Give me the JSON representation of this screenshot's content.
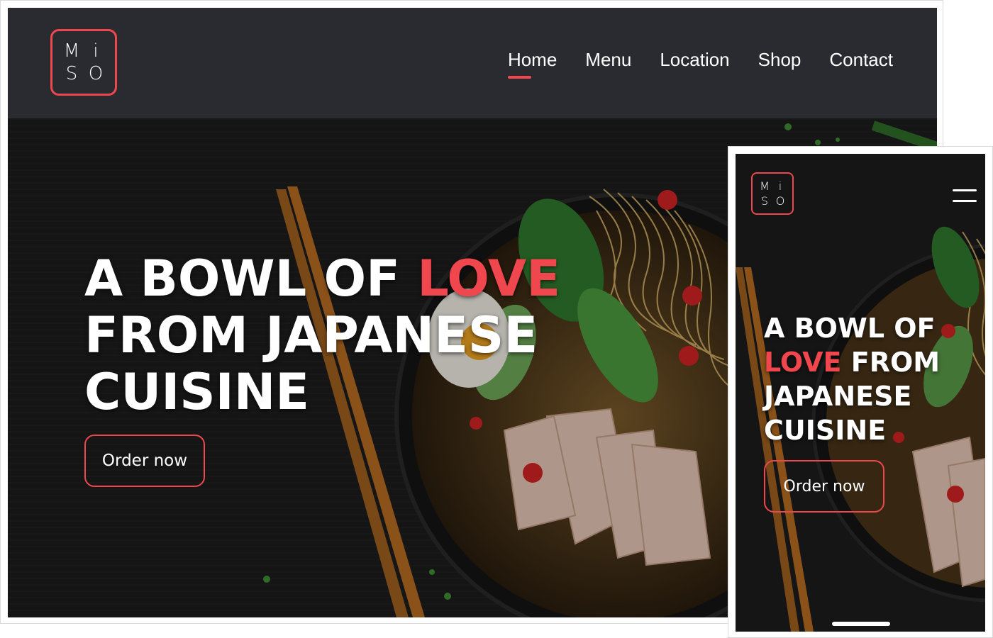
{
  "brand": {
    "logo_letters": [
      "M",
      "i",
      "S",
      "O"
    ],
    "accent_color": "#f0474f",
    "nav_background": "#2a2b30"
  },
  "desktop": {
    "nav": [
      {
        "label": "Home",
        "active": true
      },
      {
        "label": "Menu",
        "active": false
      },
      {
        "label": "Location",
        "active": false
      },
      {
        "label": "Shop",
        "active": false
      },
      {
        "label": "Contact",
        "active": false
      }
    ],
    "hero": {
      "line1_pre": "A BOWL OF ",
      "line1_accent": "LOVE",
      "line2": "FROM JAPANESE",
      "line3": "CUISINE",
      "cta_label": "Order now",
      "image_subject": "ramen-bowl-with-chopsticks"
    }
  },
  "mobile": {
    "menu_icon": "hamburger-icon",
    "hero": {
      "line1": "A BOWL OF",
      "line2_accent": "LOVE",
      "line2_post": " FROM",
      "line3": "JAPANESE",
      "line4": "CUISINE",
      "cta_label": "Order now"
    }
  }
}
